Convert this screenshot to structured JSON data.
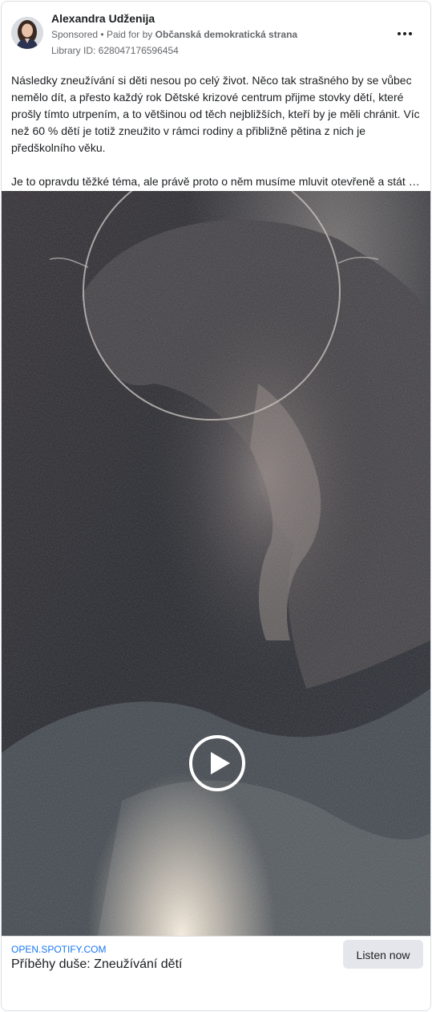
{
  "header": {
    "advertiser_name": "Alexandra Udženija",
    "sponsored_label": "Sponsored",
    "separator": "•",
    "paid_for_prefix": "Paid for by",
    "paid_for_by": "Občanská demokratická strana",
    "library_id_label": "Library ID: 628047176596454",
    "more_icon": "ellipsis-horizontal-icon"
  },
  "body": {
    "paragraph_1": "Následky zneužívání si děti nesou po celý život. Něco tak strašného by se vůbec nemělo dít, a přesto každý rok Dětské krizové centrum přijme stovky dětí, které prošly tímto utrpením, a to většinou od těch nejbližších, kteří by je měli chránit. Víc než 60 % dětí je totiž zneužito v rámci rodiny a přibližně pětina z nich je předškolního věku.",
    "paragraph_2": "Je to opravdu těžké téma, ale právě proto o něm musíme mluvit otevřeně a stát p…"
  },
  "media": {
    "type": "video",
    "play_icon": "play-circle-icon"
  },
  "link": {
    "domain": "OPEN.SPOTIFY.COM",
    "title": "Příběhy duše: Zneužívání dětí",
    "cta_label": "Listen now"
  },
  "colors": {
    "link_blue": "#1877f2",
    "secondary_text": "#65676b",
    "primary_text": "#1c1e21",
    "button_bg": "#e4e6eb",
    "border": "#dadde1"
  }
}
